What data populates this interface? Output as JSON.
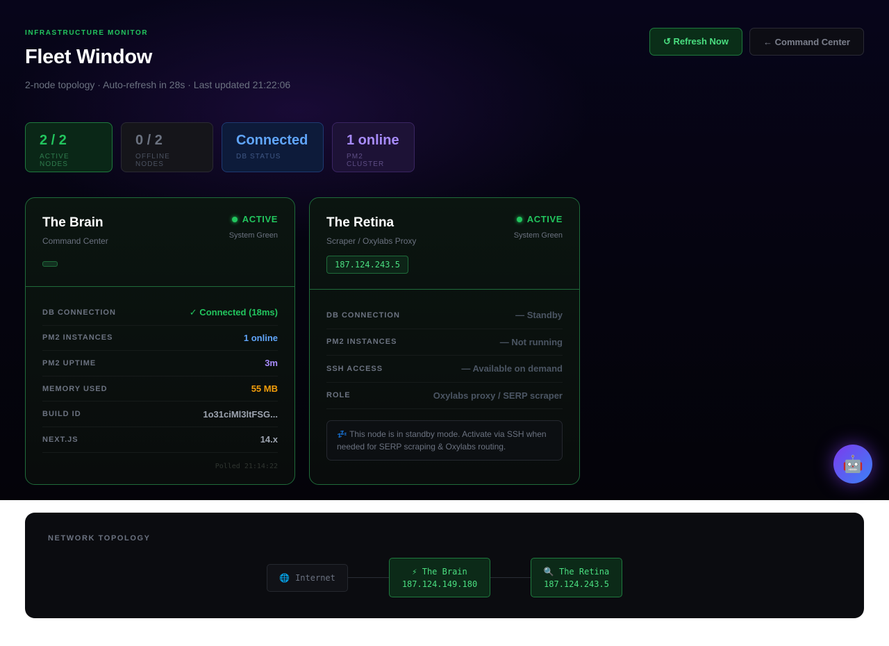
{
  "header": {
    "eyebrow": "INFRASTRUCTURE MONITOR",
    "title": "Fleet Window",
    "subtitle": "2-node topology · Auto-refresh in 28s · Last updated 21:22:06"
  },
  "actions": {
    "refresh_label": "↺ Refresh Now",
    "command_center_label": "← Command Center"
  },
  "stats": {
    "active": {
      "value": "2 / 2",
      "label": "ACTIVE NODES"
    },
    "offline": {
      "value": "0 / 2",
      "label": "OFFLINE NODES"
    },
    "db": {
      "value": "Connected",
      "label": "DB STATUS"
    },
    "pm2": {
      "value": "1 online",
      "label": "PM2 CLUSTER"
    }
  },
  "nodes": {
    "brain": {
      "name": "The Brain",
      "role": "Command Center",
      "status": "ACTIVE",
      "status_sub": "System Green",
      "rows": {
        "db": {
          "key": "DB CONNECTION",
          "value": "✓ Connected (18ms)"
        },
        "pm2": {
          "key": "PM2 INSTANCES",
          "value": "1 online"
        },
        "uptime": {
          "key": "PM2 UPTIME",
          "value": "3m"
        },
        "memory": {
          "key": "MEMORY USED",
          "value": "55 MB"
        },
        "build": {
          "key": "BUILD ID",
          "value": "1o31ciMl3ltFSG..."
        },
        "next": {
          "key": "NEXT.JS",
          "value": "14.x"
        }
      },
      "polled": "Polled 21:14:22"
    },
    "retina": {
      "name": "The Retina",
      "role": "Scraper / Oxylabs Proxy",
      "ip": "187.124.243.5",
      "status": "ACTIVE",
      "status_sub": "System Green",
      "rows": {
        "db": {
          "key": "DB CONNECTION",
          "value": "— Standby"
        },
        "pm2": {
          "key": "PM2 INSTANCES",
          "value": "— Not running"
        },
        "ssh": {
          "key": "SSH ACCESS",
          "value": "— Available on demand"
        },
        "role": {
          "key": "ROLE",
          "value": "Oxylabs proxy / SERP scraper"
        }
      },
      "note_icon": "💤",
      "note": "This node is in standby mode. Activate via SSH when needed for SERP scraping & Oxylabs routing."
    }
  },
  "assistant": {
    "icon": "🤖"
  },
  "topology": {
    "title": "NETWORK TOPOLOGY",
    "internet": {
      "icon": "🌐",
      "label": "Internet"
    },
    "brain": {
      "icon": "⚡",
      "label": "The Brain",
      "ip": "187.124.149.180"
    },
    "retina": {
      "icon": "🔍",
      "label": "The Retina",
      "ip": "187.124.243.5"
    }
  },
  "colors": {
    "accent_green": "#22c55e",
    "accent_blue": "#60a5fa",
    "accent_purple": "#a78bfa",
    "accent_orange": "#f59e0b",
    "background": "#05040f"
  }
}
